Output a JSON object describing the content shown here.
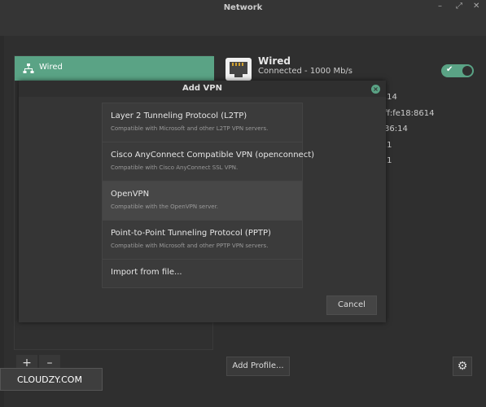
{
  "window": {
    "title": "Network",
    "controls": [
      "–",
      "⤢",
      "✕"
    ]
  },
  "sidebar": {
    "items": [
      {
        "label": "Wired",
        "icon": "network-wired-icon"
      }
    ]
  },
  "controls": {
    "add_label": "+",
    "remove_label": "–"
  },
  "wired": {
    "title": "Wired",
    "status": "Connected - 1000 Mb/s",
    "toggle_on": true,
    "details": [
      ".14",
      "ff:fe18:8614",
      "36:14",
      ".1",
      ".1"
    ]
  },
  "add_profile_label": "Add Profile...",
  "settings_icon": "gear-icon",
  "dialog": {
    "title": "Add VPN",
    "options": [
      {
        "name": "Layer 2 Tunneling Protocol (L2TP)",
        "desc": "Compatible with Microsoft and other L2TP VPN servers."
      },
      {
        "name": "Cisco AnyConnect Compatible VPN (openconnect)",
        "desc": "Compatible with Cisco AnyConnect SSL VPN."
      },
      {
        "name": "OpenVPN",
        "desc": "Compatible with the OpenVPN server."
      },
      {
        "name": "Point-to-Point Tunneling Protocol (PPTP)",
        "desc": "Compatible with Microsoft and other PPTP VPN servers."
      }
    ],
    "import_label": "Import from file...",
    "cancel_label": "Cancel"
  },
  "watermark": "CLOUDZY.COM",
  "colors": {
    "accent": "#5aa385",
    "bg": "#2b2b2b",
    "dialog_bg": "#353535"
  }
}
